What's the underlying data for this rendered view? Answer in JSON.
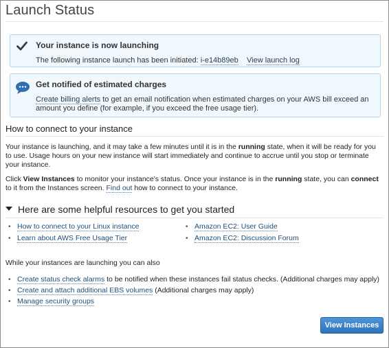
{
  "page": {
    "title": "Launch Status"
  },
  "launch_box": {
    "heading": "Your instance is now launching",
    "text_prefix": "The following instance launch has been initiated:",
    "instance_id": "i-e14b89eb",
    "view_log_label": "View launch log",
    "icon": "check-icon"
  },
  "billing_box": {
    "heading": "Get notified of estimated charges",
    "link_label": "Create billing alerts",
    "text_line1": "to get an email notification when estimated charges on your AWS bill exceed an",
    "text_line2": "amount you define (for example, if you exceed the free usage tier).",
    "icon": "chat-bubble-icon"
  },
  "connect_section": {
    "heading": "How to connect to your instance",
    "p1": {
      "a": "Your instance is launching, and it may take a few minutes until it is in the",
      "b": "running",
      "c": "state, when it will be ready for you to use. Usage hours on your new instance will start immediately and continue to accrue until you stop or terminate your instance."
    },
    "p2": {
      "a": "Click",
      "b": "View Instances",
      "c": "to monitor your instance's status. Once your instance is in the",
      "d": "running",
      "e": "state, you can",
      "f": "connect",
      "g": "to it from the Instances screen.",
      "link": "Find out",
      "h": "how to connect to your instance."
    }
  },
  "resources": {
    "heading": "Here are some helpful resources to get you started",
    "left": [
      "How to connect to your Linux instance",
      "Learn about AWS Free Usage Tier"
    ],
    "right": [
      "Amazon EC2: User Guide",
      "Amazon EC2: Discussion Forum"
    ]
  },
  "also": {
    "intro": "While your instances are launching you can also",
    "items": [
      {
        "link": "Create status check alarms",
        "rest": "to be notified when these instances fail status checks. (Additional charges may apply)"
      },
      {
        "link": "Create and attach additional EBS volumes",
        "rest": "(Additional charges may apply)"
      },
      {
        "link": "Manage security groups",
        "rest": ""
      }
    ]
  },
  "footer": {
    "view_instances_label": "View Instances"
  },
  "colors": {
    "accent": "#2e74bd",
    "box_bg": "#f1f8fd",
    "box_border": "#b3d4ea",
    "link": "#1f4e79"
  }
}
